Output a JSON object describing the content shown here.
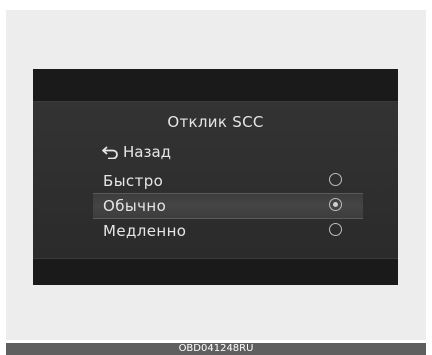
{
  "screen": {
    "title": "Отклик SCC",
    "back_label": "Назад",
    "options": [
      {
        "label": "Быстро",
        "selected": false
      },
      {
        "label": "Обычно",
        "selected": true
      },
      {
        "label": "Медленно",
        "selected": false
      }
    ]
  },
  "caption": "OBD041248RU",
  "colors": {
    "display_bg": "#2a2a2a",
    "text": "#e6e6e6",
    "caption_bg": "#5f5f5f"
  },
  "icons": {
    "back": "return-arrow-icon",
    "radio": "radio-button-icon"
  }
}
